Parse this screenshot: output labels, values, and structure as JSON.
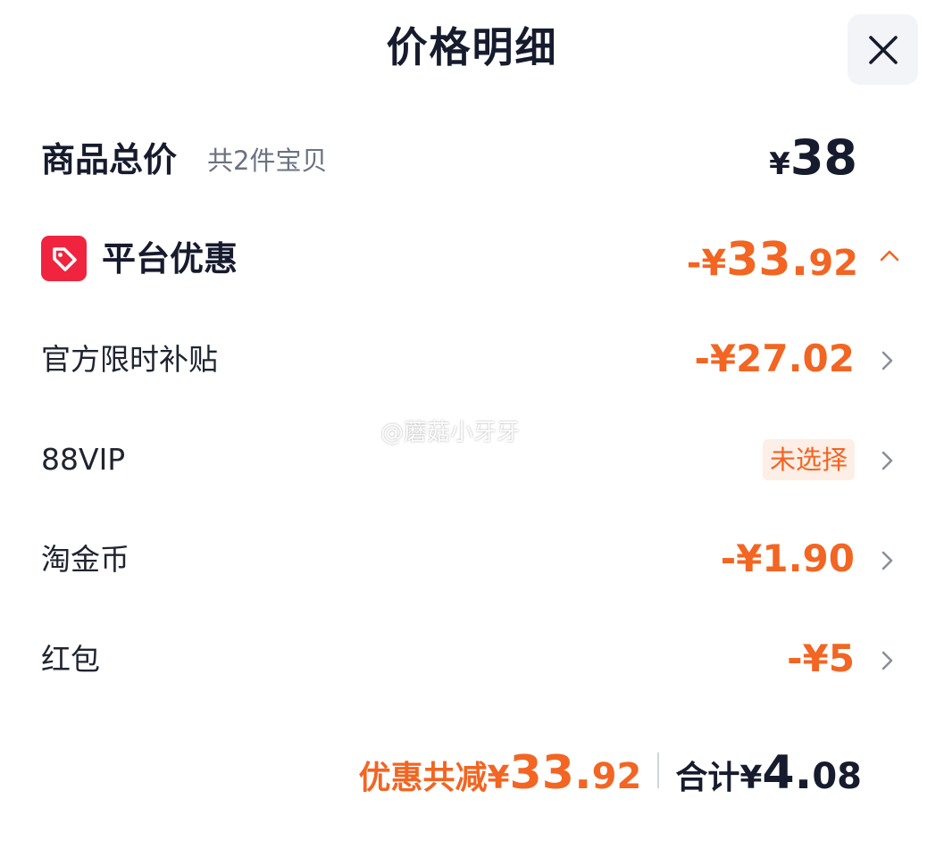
{
  "header": {
    "title": "价格明细",
    "close_icon": "close-icon"
  },
  "total": {
    "label": "商品总价",
    "sub": "共2件宝贝",
    "currency": "¥",
    "amount": "38"
  },
  "platform": {
    "icon": "tag-icon",
    "label": "平台优惠",
    "sign_currency": "-¥",
    "amount_int": "33.",
    "amount_dec": "92",
    "expand_icon": "chevron-up-icon"
  },
  "rows": [
    {
      "label": "官方限时补贴",
      "value": "-¥27.02"
    },
    {
      "label": "88VIP",
      "badge": "未选择"
    },
    {
      "label": "淘金币",
      "value": "-¥1.90"
    },
    {
      "label": "红包",
      "value": "-¥5"
    }
  ],
  "watermark": "@蘑菇小牙牙",
  "footer": {
    "discount_label": "优惠共减",
    "discount_currency": "¥",
    "discount_int": "33.",
    "discount_dec": "92",
    "sum_label": "合计",
    "sum_currency": "¥",
    "sum_int": "4.",
    "sum_dec": "08"
  },
  "colors": {
    "accent": "#f26522",
    "tag_red": "#f0243f",
    "text_dark": "#161b2e",
    "muted": "#6b7280"
  }
}
